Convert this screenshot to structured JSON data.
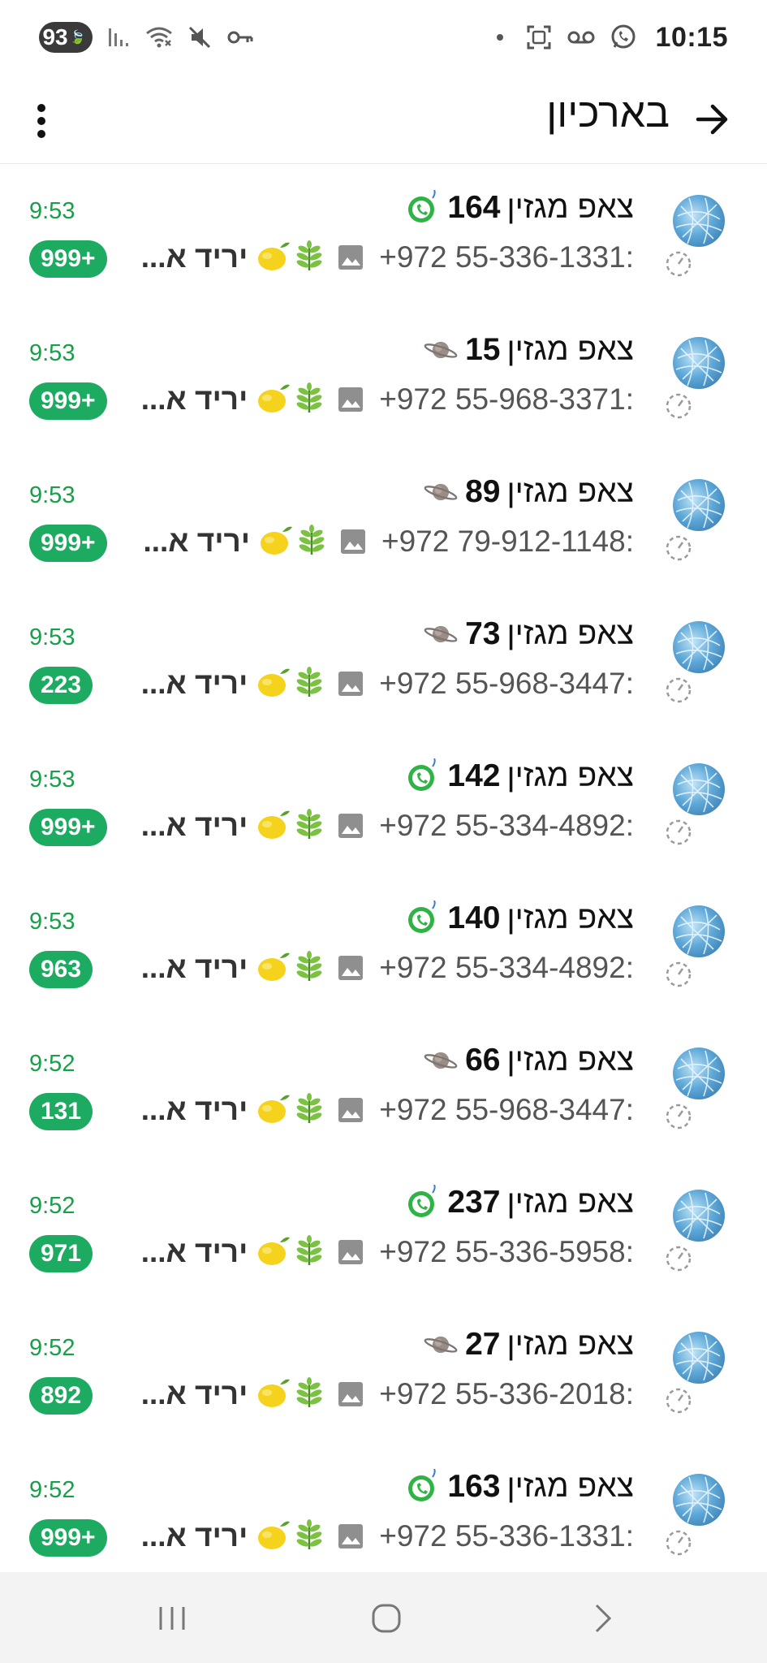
{
  "status_bar": {
    "battery": "93",
    "time": "10:15"
  },
  "app_bar": {
    "title": "בארכיון"
  },
  "chats": [
    {
      "name": "צאפ מגזין",
      "number": "164",
      "emoji": "whatsapp",
      "time": "9:53",
      "phone": "+972 55-336-1331:",
      "snippet": "יריד א...",
      "badge": "999+"
    },
    {
      "name": "צאפ מגזין",
      "number": "15",
      "emoji": "saturn",
      "time": "9:53",
      "phone": "+972 55-968-3371:",
      "snippet": "יריד א...",
      "badge": "999+"
    },
    {
      "name": "צאפ מגזין",
      "number": "89",
      "emoji": "saturn",
      "time": "9:53",
      "phone": "+972 79-912-1148:",
      "snippet": "יריד א...",
      "badge": "999+"
    },
    {
      "name": "צאפ מגזין",
      "number": "73",
      "emoji": "saturn",
      "time": "9:53",
      "phone": "+972 55-968-3447:",
      "snippet": "יריד א...",
      "badge": "223"
    },
    {
      "name": "צאפ מגזין",
      "number": "142",
      "emoji": "whatsapp",
      "time": "9:53",
      "phone": "+972 55-334-4892:",
      "snippet": "יריד א...",
      "badge": "999+"
    },
    {
      "name": "צאפ מגזין",
      "number": "140",
      "emoji": "whatsapp",
      "time": "9:53",
      "phone": "+972 55-334-4892:",
      "snippet": "יריד א...",
      "badge": "963"
    },
    {
      "name": "צאפ מגזין",
      "number": "66",
      "emoji": "saturn",
      "time": "9:52",
      "phone": "+972 55-968-3447:",
      "snippet": "יריד א...",
      "badge": "131"
    },
    {
      "name": "צאפ מגזין",
      "number": "237",
      "emoji": "whatsapp",
      "time": "9:52",
      "phone": "+972 55-336-5958:",
      "snippet": "יריד א...",
      "badge": "971"
    },
    {
      "name": "צאפ מגזין",
      "number": "27",
      "emoji": "saturn",
      "time": "9:52",
      "phone": "+972 55-336-2018:",
      "snippet": "יריד א...",
      "badge": "892"
    },
    {
      "name": "צאפ מגזין",
      "number": "163",
      "emoji": "whatsapp",
      "time": "9:52",
      "phone": "+972 55-336-1331:",
      "snippet": "יריד א...",
      "badge": "999+"
    }
  ],
  "colors": {
    "accent_green": "#1daa61",
    "time_green": "#1a9e4b"
  }
}
